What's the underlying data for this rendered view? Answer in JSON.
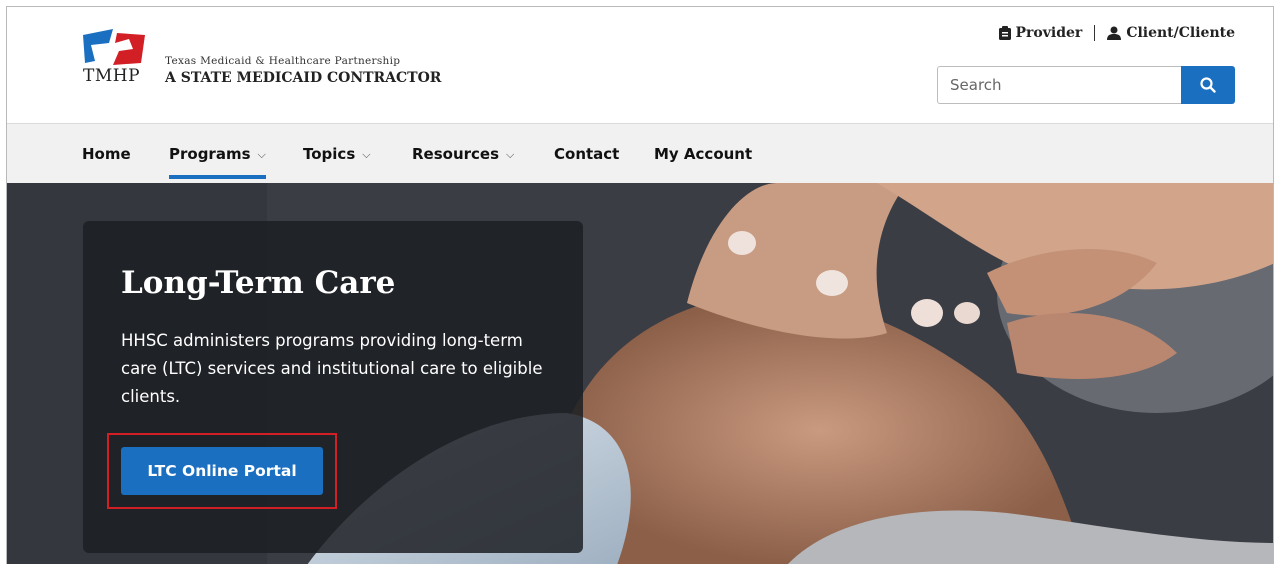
{
  "brand": {
    "logo_text": "TMHP",
    "tagline_line1": "Texas Medicaid & Healthcare Partnership",
    "tagline_line2": "A STATE MEDICAID CONTRACTOR",
    "colors": {
      "blue": "#1b6fc0",
      "red": "#d21f26"
    }
  },
  "top_links": [
    {
      "label": "Provider",
      "icon": "clipboard-icon"
    },
    {
      "label": "Client/Cliente",
      "icon": "person-icon"
    }
  ],
  "search": {
    "placeholder": "Search",
    "button_icon": "search-icon"
  },
  "nav": {
    "items": [
      {
        "label": "Home",
        "has_menu": false,
        "active": false
      },
      {
        "label": "Programs",
        "has_menu": true,
        "active": true
      },
      {
        "label": "Topics",
        "has_menu": true,
        "active": false
      },
      {
        "label": "Resources",
        "has_menu": true,
        "active": false
      },
      {
        "label": "Contact",
        "has_menu": false,
        "active": false
      },
      {
        "label": "My Account",
        "has_menu": false,
        "active": false
      }
    ],
    "chevron": "⌵"
  },
  "hero": {
    "title": "Long-Term Care",
    "body": "HHSC administers programs providing long-term care (LTC) services and institutional care to eligible clients.",
    "cta_label": "LTC Online Portal",
    "highlight_color": "#d21f26"
  }
}
